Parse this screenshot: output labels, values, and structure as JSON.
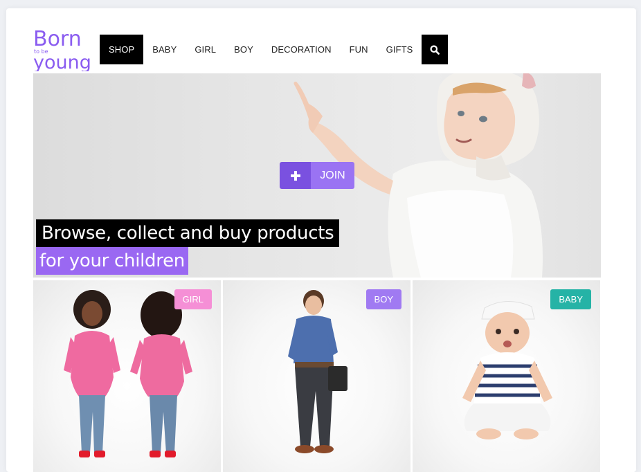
{
  "logo": {
    "line1": "Born",
    "small": "to be",
    "line2": "young",
    "color": "#8a5cf0"
  },
  "nav": {
    "items": [
      "SHOP",
      "BABY",
      "GIRL",
      "BOY",
      "DECORATION",
      "FUN",
      "GIFTS"
    ],
    "active_index": 0,
    "search_icon": "search-icon"
  },
  "hero": {
    "join_label": "JOIN",
    "join_icon": "plus-icon",
    "headline_line1": "Browse, collect and buy products",
    "headline_line2": "for your children"
  },
  "categories": [
    {
      "label": "GIRL",
      "color": "#f58fd6"
    },
    {
      "label": "BOY",
      "color": "#a07af2"
    },
    {
      "label": "BABY",
      "color": "#25b3a6"
    }
  ],
  "colors": {
    "accent": "#9a68f2",
    "accent_dark": "#7a51e0",
    "nav_active": "#000000"
  }
}
